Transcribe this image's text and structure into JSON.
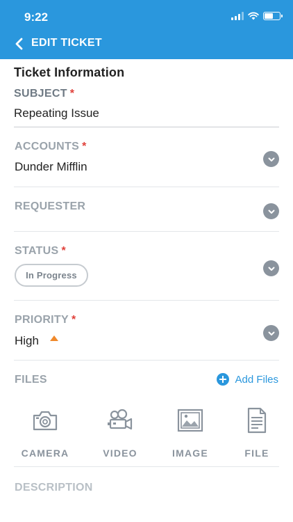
{
  "status_bar": {
    "time": "9:22"
  },
  "nav": {
    "title": "EDIT TICKET"
  },
  "section": {
    "title": "Ticket Information"
  },
  "fields": {
    "subject": {
      "label": "SUBJECT",
      "required": "*",
      "value": "Repeating Issue"
    },
    "accounts": {
      "label": "ACCOUNTS",
      "required": "*",
      "value": "Dunder Mifflin"
    },
    "requester": {
      "label": "REQUESTER",
      "value": ""
    },
    "status": {
      "label": "STATUS",
      "required": "*",
      "value": "In Progress"
    },
    "priority": {
      "label": "PRIORITY",
      "required": "*",
      "value": "High",
      "icon": "triangle-up-icon",
      "icon_color": "#f0892b"
    }
  },
  "files": {
    "label": "FILES",
    "add_label": "Add Files",
    "options": [
      {
        "label": "CAMERA",
        "icon": "camera-icon"
      },
      {
        "label": "VIDEO",
        "icon": "video-camera-icon"
      },
      {
        "label": "IMAGE",
        "icon": "image-icon"
      },
      {
        "label": "FILE",
        "icon": "file-icon"
      }
    ]
  },
  "description": {
    "label": "DESCRIPTION"
  },
  "colors": {
    "brand": "#2a97dd",
    "required": "#e0403a",
    "priority_high": "#f0892b",
    "muted": "#9aa3ab"
  }
}
